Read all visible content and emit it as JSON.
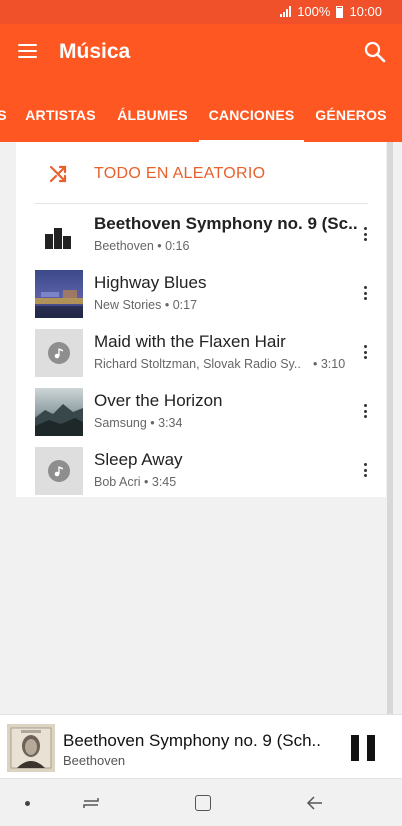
{
  "status_bar": {
    "battery": "100%",
    "time": "10:00"
  },
  "app_bar": {
    "title": "Música",
    "menu_icon": "hamburger-menu-icon",
    "search_icon": "search-icon"
  },
  "tabs": [
    {
      "label": "S",
      "active": false
    },
    {
      "label": "ARTISTAS",
      "active": false
    },
    {
      "label": "ÁLBUMES",
      "active": false
    },
    {
      "label": "CANCIONES",
      "active": true
    },
    {
      "label": "GÉNEROS",
      "active": false
    }
  ],
  "shuffle": {
    "label": "TODO EN ALEATORIO",
    "icon": "shuffle-icon"
  },
  "songs": [
    {
      "title": "Beethoven Symphony no. 9 (Sc..",
      "subtitle": "Beethoven • 0:16",
      "playing": true,
      "thumb": "equalizer-icon"
    },
    {
      "title": "Highway Blues",
      "subtitle": "New Stories • 0:17",
      "playing": false,
      "thumb": "album-art-highway-blues"
    },
    {
      "title": "Maid with the Flaxen Hair",
      "subtitle": "Richard Stoltzman, Slovak Radio Sy..",
      "duration": "• 3:10",
      "playing": false,
      "thumb": "music-note-icon"
    },
    {
      "title": "Over the Horizon",
      "subtitle": "Samsung • 3:34",
      "playing": false,
      "thumb": "album-art-over-the-horizon"
    },
    {
      "title": "Sleep Away",
      "subtitle": "Bob Acri • 3:45",
      "playing": false,
      "thumb": "music-note-icon"
    }
  ],
  "mini_player": {
    "title": "Beethoven Symphony no. 9 (Sch..",
    "artist": "Beethoven",
    "control": "pause-icon"
  },
  "colors": {
    "accent": "#ff5722",
    "status_bar": "#f0502a",
    "shuffle_text": "#e8602c"
  }
}
